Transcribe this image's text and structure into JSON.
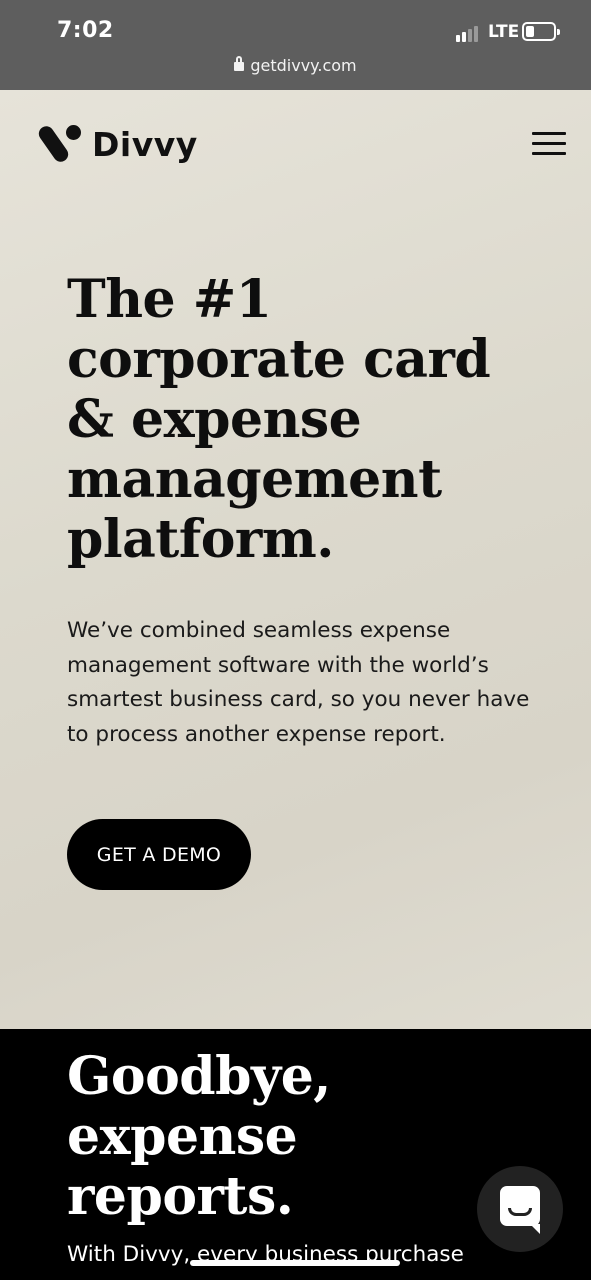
{
  "status_bar": {
    "time": "7:02",
    "network": "LTE",
    "url": "getdivvy.com"
  },
  "header": {
    "brand": "Divvy",
    "menu_icon": "hamburger-menu-icon"
  },
  "hero": {
    "headline_lines": [
      "The #1",
      "corporate card",
      "& expense",
      "management",
      "platform."
    ],
    "subtext": "We’ve combined seamless expense management software with the world’s smartest business card, so you never have to process another expense report.",
    "cta_label": "GET A DEMO"
  },
  "section2": {
    "title_lines": [
      "Goodbye,",
      "expense",
      "reports."
    ],
    "body": "With Divvy, every business purchase"
  },
  "chat": {
    "icon": "chat-icon"
  },
  "colors": {
    "hero_bg": "#dcd9cd",
    "dark_bg": "#000000",
    "status_bar_bg": "#5e5e5e",
    "cta_bg": "#000000"
  }
}
